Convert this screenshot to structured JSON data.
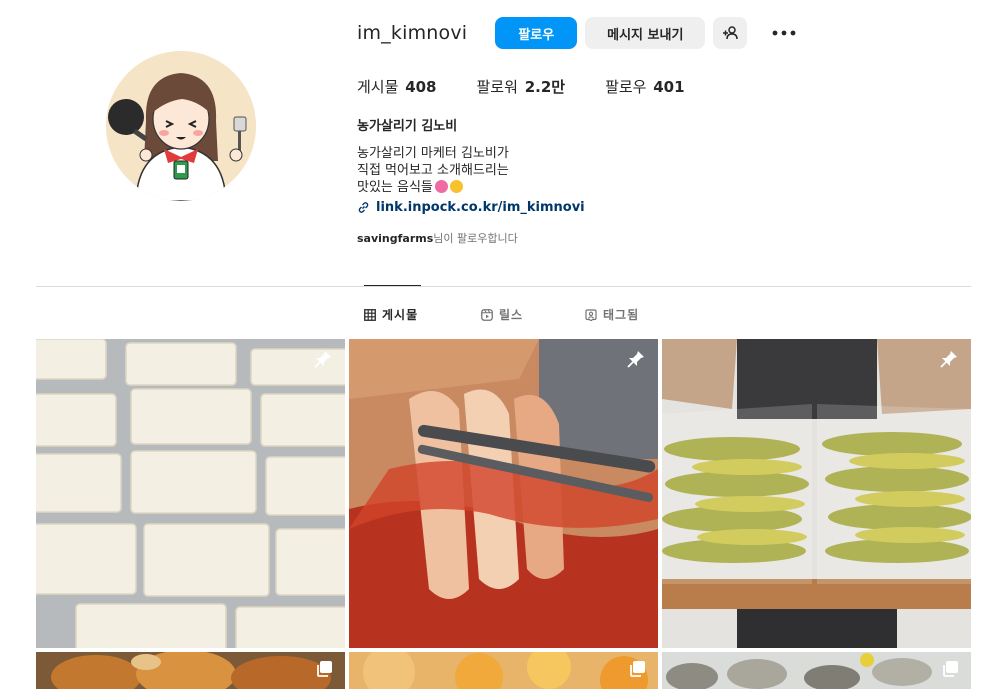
{
  "profile": {
    "username": "im_kimnovi",
    "follow_label": "팔로우",
    "message_label": "메시지 보내기",
    "stats": [
      {
        "label": "게시물",
        "value": "408"
      },
      {
        "label": "팔로워",
        "value": "2.2만"
      },
      {
        "label": "팔로우",
        "value": "401"
      }
    ],
    "full_name": "농가살리기 김노비",
    "bio_lines": [
      "농가살리기 마케터 김노비가",
      "직접 먹어보고 소개해드리는",
      "맛있는 음식들"
    ],
    "link": "link.inpock.co.kr/im_kimnovi",
    "followed_by_user": "savingfarms",
    "followed_by_suffix": "님이 팔로우합니다"
  },
  "tabs": [
    {
      "label": "게시물",
      "icon": "grid-icon",
      "active": true
    },
    {
      "label": "릴스",
      "icon": "reels-icon",
      "active": false
    },
    {
      "label": "태그됨",
      "icon": "tagged-icon",
      "active": false
    }
  ],
  "posts": [
    {
      "subject": "tofu",
      "badge": "pin-icon"
    },
    {
      "subject": "kimchi",
      "badge": "pin-icon"
    },
    {
      "subject": "pickles",
      "badge": "pin-icon"
    },
    {
      "subject": "roast-chicken",
      "badge": "multi-post-icon"
    },
    {
      "subject": "citrus",
      "badge": "multi-post-icon"
    },
    {
      "subject": "oysters",
      "badge": "multi-post-icon"
    }
  ],
  "colors": {
    "primary": "#0095f6",
    "link": "#00376b",
    "secondary_button": "#efefef",
    "muted_text": "#737373",
    "divider": "#dbdbdb"
  }
}
